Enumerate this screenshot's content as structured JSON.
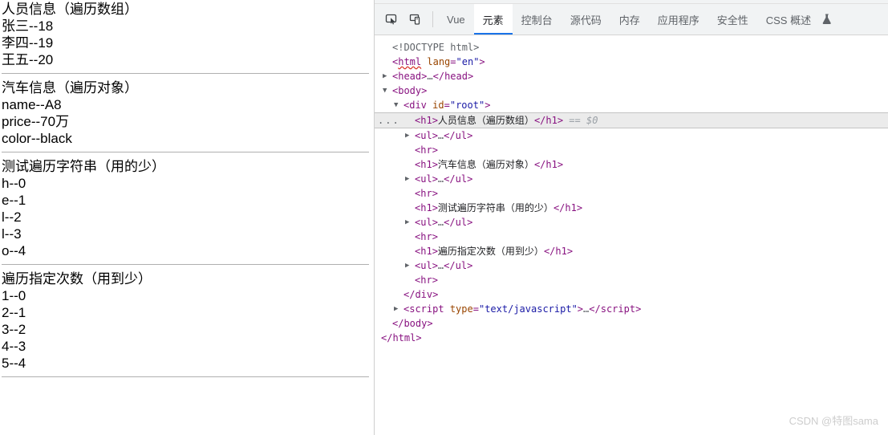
{
  "page": {
    "blocks": [
      {
        "heading": "人员信息（遍历数组）",
        "items": [
          "张三--18",
          "李四--19",
          "王五--20"
        ]
      },
      {
        "heading": "汽车信息（遍历对象）",
        "items": [
          "name--A8",
          "price--70万",
          "color--black"
        ]
      },
      {
        "heading": "测试遍历字符串（用的少）",
        "items": [
          "h--0",
          "e--1",
          "l--2",
          "l--3",
          "o--4"
        ]
      },
      {
        "heading": "遍历指定次数（用到少）",
        "items": [
          "1--0",
          "2--1",
          "3--2",
          "4--3",
          "5--4"
        ]
      }
    ]
  },
  "devtools": {
    "toolbar": {
      "inspect_icon": "inspect-element-icon",
      "device_icon": "device-toolbar-icon",
      "flask_icon": "experiments-flask-icon"
    },
    "tabs": [
      {
        "label": "Vue",
        "active": false
      },
      {
        "label": "元素",
        "active": true
      },
      {
        "label": "控制台",
        "active": false
      },
      {
        "label": "源代码",
        "active": false
      },
      {
        "label": "内存",
        "active": false
      },
      {
        "label": "应用程序",
        "active": false
      },
      {
        "label": "安全性",
        "active": false
      },
      {
        "label": "CSS 概述",
        "active": false
      }
    ],
    "tree": [
      {
        "indent": 1,
        "twisty": "none",
        "selected": false,
        "markup": "doctype"
      },
      {
        "indent": 1,
        "twisty": "none",
        "selected": false,
        "markup": "html_open"
      },
      {
        "indent": 1,
        "twisty": "collapsed",
        "selected": false,
        "markup": "head_collapsed"
      },
      {
        "indent": 1,
        "twisty": "expanded",
        "selected": false,
        "markup": "body_open"
      },
      {
        "indent": 2,
        "twisty": "expanded",
        "selected": false,
        "markup": "div_root_open"
      },
      {
        "indent": 3,
        "twisty": "none",
        "selected": true,
        "markup": "h1_people"
      },
      {
        "indent": 3,
        "twisty": "collapsed",
        "selected": false,
        "markup": "ul_collapsed"
      },
      {
        "indent": 3,
        "twisty": "none",
        "selected": false,
        "markup": "hr"
      },
      {
        "indent": 3,
        "twisty": "none",
        "selected": false,
        "markup": "h1_car"
      },
      {
        "indent": 3,
        "twisty": "collapsed",
        "selected": false,
        "markup": "ul_collapsed"
      },
      {
        "indent": 3,
        "twisty": "none",
        "selected": false,
        "markup": "hr"
      },
      {
        "indent": 3,
        "twisty": "none",
        "selected": false,
        "markup": "h1_string"
      },
      {
        "indent": 3,
        "twisty": "collapsed",
        "selected": false,
        "markup": "ul_collapsed"
      },
      {
        "indent": 3,
        "twisty": "none",
        "selected": false,
        "markup": "hr"
      },
      {
        "indent": 3,
        "twisty": "none",
        "selected": false,
        "markup": "h1_times"
      },
      {
        "indent": 3,
        "twisty": "collapsed",
        "selected": false,
        "markup": "ul_collapsed"
      },
      {
        "indent": 3,
        "twisty": "none",
        "selected": false,
        "markup": "hr"
      },
      {
        "indent": 2,
        "twisty": "none",
        "selected": false,
        "markup": "div_close"
      },
      {
        "indent": 2,
        "twisty": "collapsed",
        "selected": false,
        "markup": "script_collapsed"
      },
      {
        "indent": 1,
        "twisty": "none",
        "selected": false,
        "markup": "body_close"
      },
      {
        "indent": 0,
        "twisty": "none",
        "selected": false,
        "markup": "html_close"
      }
    ],
    "tokens": {
      "doctype": "<!DOCTYPE html>",
      "html_tag": "html",
      "html_attr_name": "lang",
      "html_attr_value": "\"en\"",
      "head_tag": "head",
      "body_tag": "body",
      "div_tag": "div",
      "div_attr_name": "id",
      "div_attr_value": "\"root\"",
      "h1_tag": "h1",
      "ul_tag": "ul",
      "hr_tag": "hr",
      "script_tag": "script",
      "script_attr_name": "type",
      "script_attr_value": "\"text/javascript\"",
      "ellipsis": "…",
      "selected_marker": "== $0",
      "breadcrumb_dots": "...",
      "h1_people_text": "人员信息（遍历数组）",
      "h1_car_text": "汽车信息（遍历对象）",
      "h1_string_text": "测试遍历字符串（用的少）",
      "h1_times_text": "遍历指定次数（用到少）"
    }
  },
  "watermark": {
    "text": "CSDN @特图sama"
  },
  "colors": {
    "accent": "#1a73e8",
    "tag": "#881280",
    "attr_name": "#994500",
    "attr_value": "#1a1aa6",
    "dim": "#9aa0a6",
    "selected_row": "#ebebeb",
    "toolbar_bg": "#f1f3f4"
  }
}
